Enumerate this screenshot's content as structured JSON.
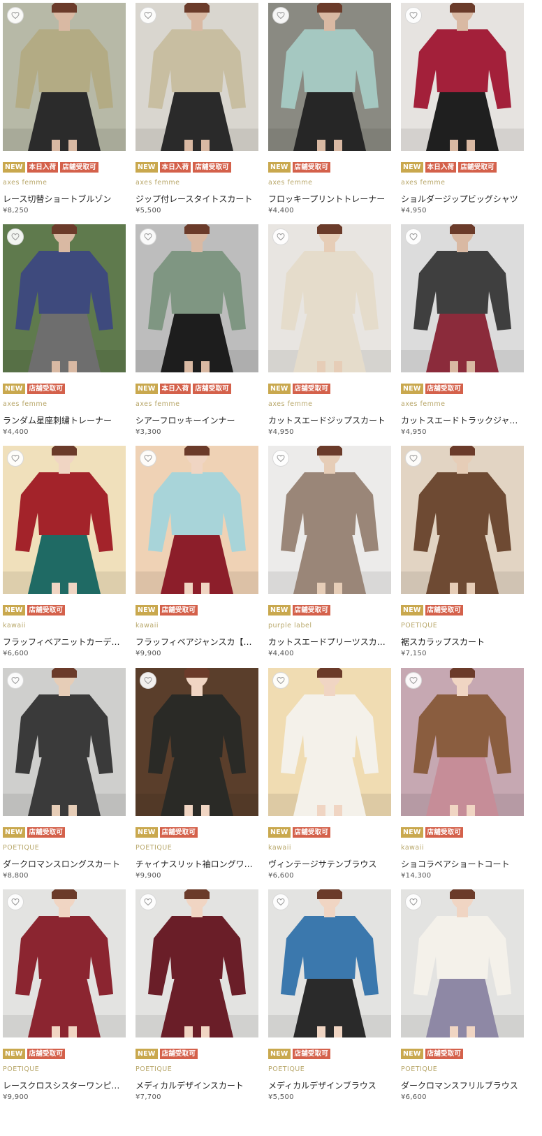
{
  "icons": {
    "favorite": "heart-outline-icon"
  },
  "colors": {
    "badge_new": "#c9a84e",
    "badge_tag": "#d4614b",
    "brand_text": "#b8a76a"
  },
  "products": [
    {
      "brand": "axes femme",
      "name": "レース切替ショートブルゾン",
      "price": "¥8,250",
      "badges": [
        "NEW",
        "本日入荷",
        "店舗受取可"
      ],
      "bg": "#b7b9a7",
      "garment": "#b3ab84",
      "bottom": "#2b2b2b",
      "skin": "#d9b9a3"
    },
    {
      "brand": "axes femme",
      "name": "ジップ付レースタイトスカート",
      "price": "¥5,500",
      "badges": [
        "NEW",
        "本日入荷",
        "店舗受取可"
      ],
      "bg": "#d9d6cf",
      "garment": "#c8bea1",
      "bottom": "#2a2a2a",
      "skin": "#d9b9a3"
    },
    {
      "brand": "axes femme",
      "name": "フロッキープリントトレーナー",
      "price": "¥4,400",
      "badges": [
        "NEW",
        "店舗受取可"
      ],
      "bg": "#8a8a82",
      "garment": "#a5c8c1",
      "bottom": "#262626",
      "skin": "#d9b9a3"
    },
    {
      "brand": "axes femme",
      "name": "ショルダージップビッグシャツ",
      "price": "¥4,950",
      "badges": [
        "NEW",
        "本日入荷",
        "店舗受取可"
      ],
      "bg": "#e6e3e0",
      "garment": "#a3203a",
      "bottom": "#1f1f1f",
      "skin": "#d9b9a3"
    },
    {
      "brand": "axes femme",
      "name": "ランダム星座刺繍トレーナー",
      "price": "¥4,400",
      "badges": [
        "NEW",
        "店舗受取可"
      ],
      "bg": "#5f7a4d",
      "garment": "#3e4a7d",
      "bottom": "#6e6e6e",
      "skin": "#d9b9a3"
    },
    {
      "brand": "axes femme",
      "name": "シアーフロッキーインナー",
      "price": "¥3,300",
      "badges": [
        "NEW",
        "本日入荷",
        "店舗受取可"
      ],
      "bg": "#bdbdbd",
      "garment": "#7f9682",
      "bottom": "#1d1d1d",
      "skin": "#d9b9a3"
    },
    {
      "brand": "axes femme",
      "name": "カットスエードジップスカート",
      "price": "¥4,950",
      "badges": [
        "NEW",
        "店舗受取可"
      ],
      "bg": "#e8e5e1",
      "garment": "#e5dccb",
      "bottom": "#e5dccb",
      "skin": "#e6cdb7"
    },
    {
      "brand": "axes femme",
      "name": "カットスエードトラックジャ…",
      "price": "¥4,950",
      "badges": [
        "NEW",
        "店舗受取可"
      ],
      "bg": "#dcdcdc",
      "garment": "#3f3f3f",
      "bottom": "#8b2b3b",
      "skin": "#d9b9a3"
    },
    {
      "brand": "kawaii",
      "name": "フラッフィベアニットカーデ…",
      "price": "¥6,600",
      "badges": [
        "NEW",
        "店舗受取可"
      ],
      "bg": "#f0e0bb",
      "garment": "#a3232a",
      "bottom": "#1f6a64",
      "skin": "#f0d5c3"
    },
    {
      "brand": "kawaii",
      "name": "フラッフィベアジャンスカ【…",
      "price": "¥9,900",
      "badges": [
        "NEW",
        "店舗受取可"
      ],
      "bg": "#efd2b5",
      "garment": "#a8d4d9",
      "bottom": "#8c1e2a",
      "skin": "#f0d5c3"
    },
    {
      "brand": "purple label",
      "name": "カットスエードプリーツスカ…",
      "price": "¥4,400",
      "badges": [
        "NEW",
        "店舗受取可"
      ],
      "bg": "#ecebea",
      "garment": "#9a8678",
      "bottom": "#9a8678",
      "skin": "#e6cdb7"
    },
    {
      "brand": "POETIQUE",
      "name": "裾スカラップスカート",
      "price": "¥7,150",
      "badges": [
        "NEW",
        "店舗受取可"
      ],
      "bg": "#e2d4c3",
      "garment": "#6e4a33",
      "bottom": "#6e4a33",
      "skin": "#e6cdb7"
    },
    {
      "brand": "POETIQUE",
      "name": "ダークロマンスロングスカート",
      "price": "¥8,800",
      "badges": [
        "NEW",
        "店舗受取可"
      ],
      "bg": "#cfcfcd",
      "garment": "#3a3a3a",
      "bottom": "#3a3a3a",
      "skin": "#e6cdb7"
    },
    {
      "brand": "POETIQUE",
      "name": "チャイナスリット袖ロングワ…",
      "price": "¥9,900",
      "badges": [
        "NEW",
        "店舗受取可"
      ],
      "bg": "#5a3e2b",
      "garment": "#2a2a26",
      "bottom": "#2a2a26",
      "skin": "#f0d5c3"
    },
    {
      "brand": "kawaii",
      "name": "ヴィンテージサテンブラウス",
      "price": "¥6,600",
      "badges": [
        "NEW",
        "店舗受取可"
      ],
      "bg": "#f0dcb2",
      "garment": "#f4f1ea",
      "bottom": "#f4f1ea",
      "skin": "#f0d5c3"
    },
    {
      "brand": "kawaii",
      "name": "ショコラベアショートコート",
      "price": "¥14,300",
      "badges": [
        "NEW",
        "店舗受取可"
      ],
      "bg": "#c6a8b2",
      "garment": "#8a5d3f",
      "bottom": "#c68d98",
      "skin": "#f0d5c3"
    },
    {
      "brand": "POETIQUE",
      "name": "レースクロスシスターワンピ…",
      "price": "¥9,900",
      "badges": [
        "NEW",
        "店舗受取可"
      ],
      "bg": "#e3e3e1",
      "garment": "#8b2530",
      "bottom": "#8b2530",
      "skin": "#f0d5c3"
    },
    {
      "brand": "POETIQUE",
      "name": "メディカルデザインスカート",
      "price": "¥7,700",
      "badges": [
        "NEW",
        "店舗受取可"
      ],
      "bg": "#e3e3e1",
      "garment": "#6a1e28",
      "bottom": "#6a1e28",
      "skin": "#f0d5c3"
    },
    {
      "brand": "POETIQUE",
      "name": "メディカルデザインブラウス",
      "price": "¥5,500",
      "badges": [
        "NEW",
        "店舗受取可"
      ],
      "bg": "#e3e3e1",
      "garment": "#3b78ad",
      "bottom": "#2a2a2a",
      "skin": "#f0d5c3"
    },
    {
      "brand": "POETIQUE",
      "name": "ダークロマンスフリルブラウス",
      "price": "¥6,600",
      "badges": [
        "NEW",
        "店舗受取可"
      ],
      "bg": "#e3e3e1",
      "garment": "#f4f1ea",
      "bottom": "#8e88a5",
      "skin": "#f0d5c3"
    }
  ]
}
